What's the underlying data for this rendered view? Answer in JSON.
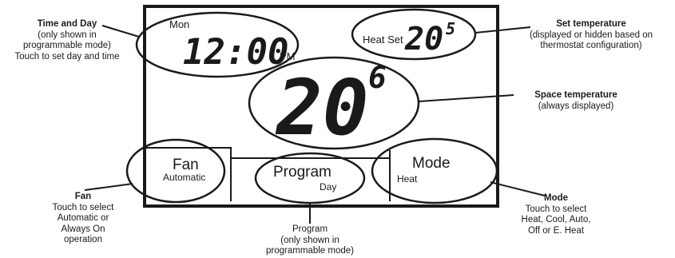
{
  "display": {
    "day": "Mon",
    "time": "12:00",
    "ampm": "PM",
    "set_label": "Heat Set",
    "set_temp_main": "20",
    "set_temp_dec": "5",
    "space_temp_main": "20",
    "space_temp_dec": "6",
    "fan_title": "Fan",
    "fan_value": "Automatic",
    "program_title": "Program",
    "program_value": "Day",
    "mode_title": "Mode",
    "mode_value": "Heat"
  },
  "callouts": {
    "time_day": {
      "title": "Time and Day",
      "lines": [
        "(only shown in",
        "programmable mode)",
        "Touch to set day and time"
      ]
    },
    "set_temp": {
      "title": "Set temperature",
      "lines": [
        "(displayed or hidden based on",
        "thermostat configuration)"
      ]
    },
    "space_temp": {
      "title": "Space temperature",
      "lines": [
        "(always displayed)"
      ]
    },
    "fan": {
      "title": "Fan",
      "lines": [
        "Touch to select",
        "Automatic or",
        "Always On",
        "operation"
      ]
    },
    "program": {
      "title": "Program",
      "lines": [
        "(only shown in",
        "programmable mode)"
      ]
    },
    "mode": {
      "title": "Mode",
      "lines": [
        "Touch to select",
        "Heat, Cool, Auto,",
        "Off or E. Heat"
      ]
    }
  }
}
